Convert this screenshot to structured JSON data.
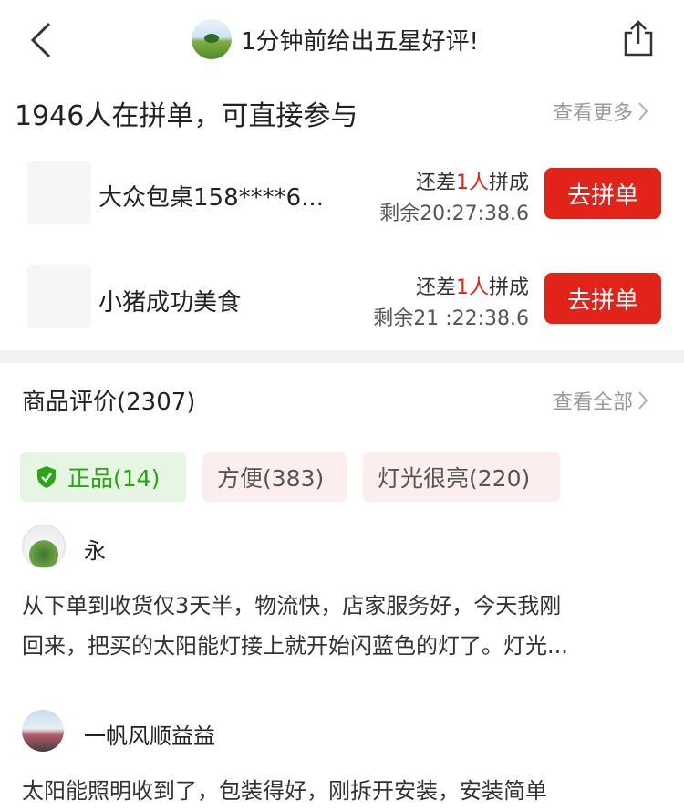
{
  "header": {
    "notice": "1分钟前给出五星好评!",
    "back_icon": "chevron-left-icon",
    "share_icon": "share-icon"
  },
  "group_buy": {
    "title": "1946人在拼单，可直接参与",
    "more_label": "查看更多",
    "rows": [
      {
        "name": "大众包桌158****6...",
        "need_prefix": "还差",
        "need_count": "1人",
        "need_suffix": "拼成",
        "time_left": "剩余20:27:38.6",
        "button": "去拼单"
      },
      {
        "name": "小猪成功美食",
        "need_prefix": "还差",
        "need_count": "1人",
        "need_suffix": "拼成",
        "time_left": "剩余21 :22:38.6",
        "button": "去拼单"
      }
    ]
  },
  "reviews": {
    "title": "商品评价(2307)",
    "all_label": "查看全部",
    "tags": [
      {
        "label": "正品(14)",
        "icon": "shield-check-icon"
      },
      {
        "label": "方便(383)"
      },
      {
        "label": "灯光很亮(220)"
      }
    ],
    "items": [
      {
        "user": "永",
        "text_line1": "从下单到收货仅3天半，物流快，店家服务好，今天我刚",
        "text_line2": "回来，把买的太阳能灯接上就开始闪蓝色的灯了。灯光..."
      },
      {
        "user": "一帆风顺益益",
        "text_line1": "太阳能照明收到了，包装得好，刚拆开安装，安装简单"
      }
    ]
  },
  "colors": {
    "accent_red": "#e2231a",
    "green": "#2aa515"
  }
}
